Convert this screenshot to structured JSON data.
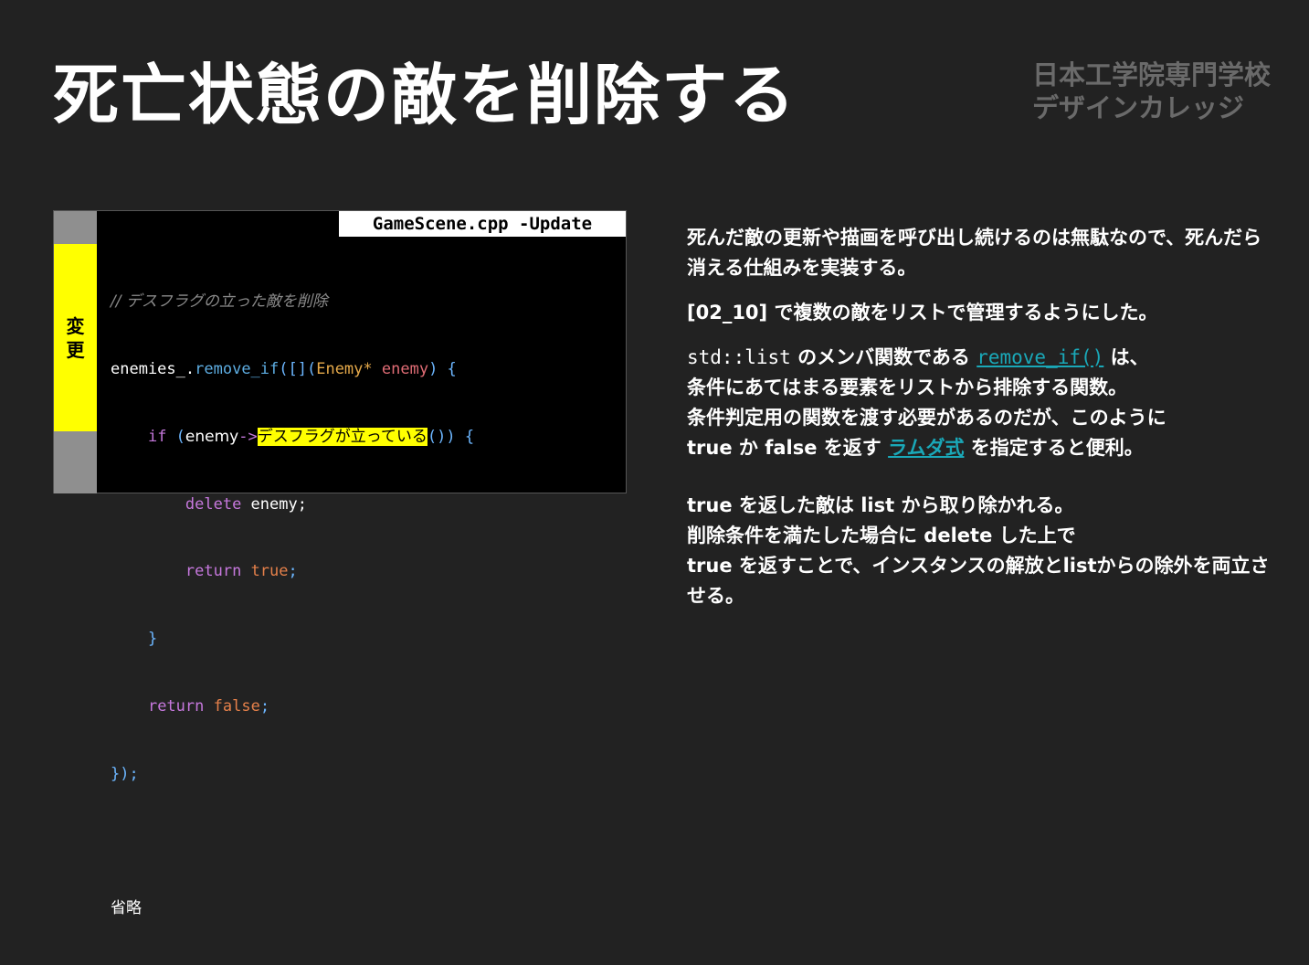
{
  "slide": {
    "title": "死亡状態の敵を削除する",
    "logo_line1": "日本工学院専門学校",
    "logo_line2": "デザインカレッジ"
  },
  "code_panel": {
    "file_tab": "GameScene.cpp -Update",
    "change_label_1": "変",
    "change_label_2": "更",
    "comment": "// デスフラグの立った敵を削除",
    "l2_obj": "enemies_",
    "l2_dot": ".",
    "l2_fn": "remove_if",
    "l2_open": "([](",
    "l2_type": "Enemy*",
    "l2_param": "enemy",
    "l2_close": ") {",
    "l3_if": "if",
    "l3_paren": " (",
    "l3_var": "enemy",
    "l3_arrow": "->",
    "l3_hl": "デスフラグが立っている",
    "l3_close": "()) {",
    "l4_kw": "delete",
    "l4_rest": " enemy;",
    "l5_kw": "return",
    "l5_val": "true",
    "l5_semi": ";",
    "l6": "}",
    "l7_kw": "return",
    "l7_val": "false",
    "l7_semi": ";",
    "l8": "});",
    "omitted": "省略"
  },
  "explanation": {
    "p1": "死んだ敵の更新や描画を呼び出し続けるのは無駄なので、死んだら消える仕組みを実装する。",
    "p2": "[02_10] で複数の敵をリストで管理するようにした。",
    "p3_code": "std::list",
    "p3_a": " のメンバ関数である ",
    "p3_link": "remove_if()",
    "p3_b": " は、",
    "p3_line2": "条件にあてはまる要素をリストから排除する関数。",
    "p3_line3": "条件判定用の関数を渡す必要があるのだが、このように",
    "p3_line4_a": "true か false を返す ",
    "p3_link2": "ラムダ式",
    "p3_line4_b": " を指定すると便利。",
    "p4_line1": "true を返した敵は list から取り除かれる。",
    "p4_line2": "削除条件を満たした場合に delete した上で",
    "p4_line3": "true を返すことで、インスタンスの解放とlistからの除外を両立させる。"
  },
  "colors": {
    "background": "#222222",
    "change_marker": "#ffff00",
    "link": "#1aa8b8"
  }
}
